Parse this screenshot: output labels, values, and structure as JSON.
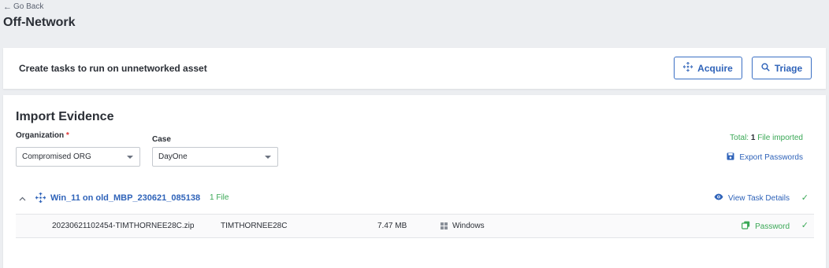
{
  "nav": {
    "go_back": "Go Back"
  },
  "page": {
    "title": "Off-Network"
  },
  "top_card": {
    "description": "Create tasks to run on unnetworked asset",
    "acquire_label": "Acquire",
    "triage_label": "Triage"
  },
  "import": {
    "title": "Import Evidence",
    "organization_label": "Organization",
    "organization_required_mark": "*",
    "organization_value": "Compromised ORG",
    "case_label": "Case",
    "case_value": "DayOne",
    "total_prefix": "Total: ",
    "total_count": "1",
    "total_suffix": " File imported",
    "export_passwords_label": "Export Passwords"
  },
  "task_group": {
    "name": "Win_11 on old_MBP_230621_085138",
    "file_count": "1 File",
    "view_details_label": "View Task Details",
    "files": [
      {
        "name": "20230621102454-TIMTHORNEE28C.zip",
        "host": "TIMTHORNEE28C",
        "size": "7.47 MB",
        "os": "Windows",
        "password_label": "Password"
      }
    ]
  },
  "colors": {
    "accent": "#2f63b9",
    "success": "#3aa856",
    "required": "#dd3333",
    "background": "#eceef1"
  },
  "icons": [
    "arrow-left-icon",
    "acquire-crosshair-icon",
    "search-icon",
    "save-icon",
    "chevron-up-icon",
    "eye-icon",
    "check-icon",
    "windows-icon",
    "copy-icon",
    "caret-down-icon"
  ]
}
